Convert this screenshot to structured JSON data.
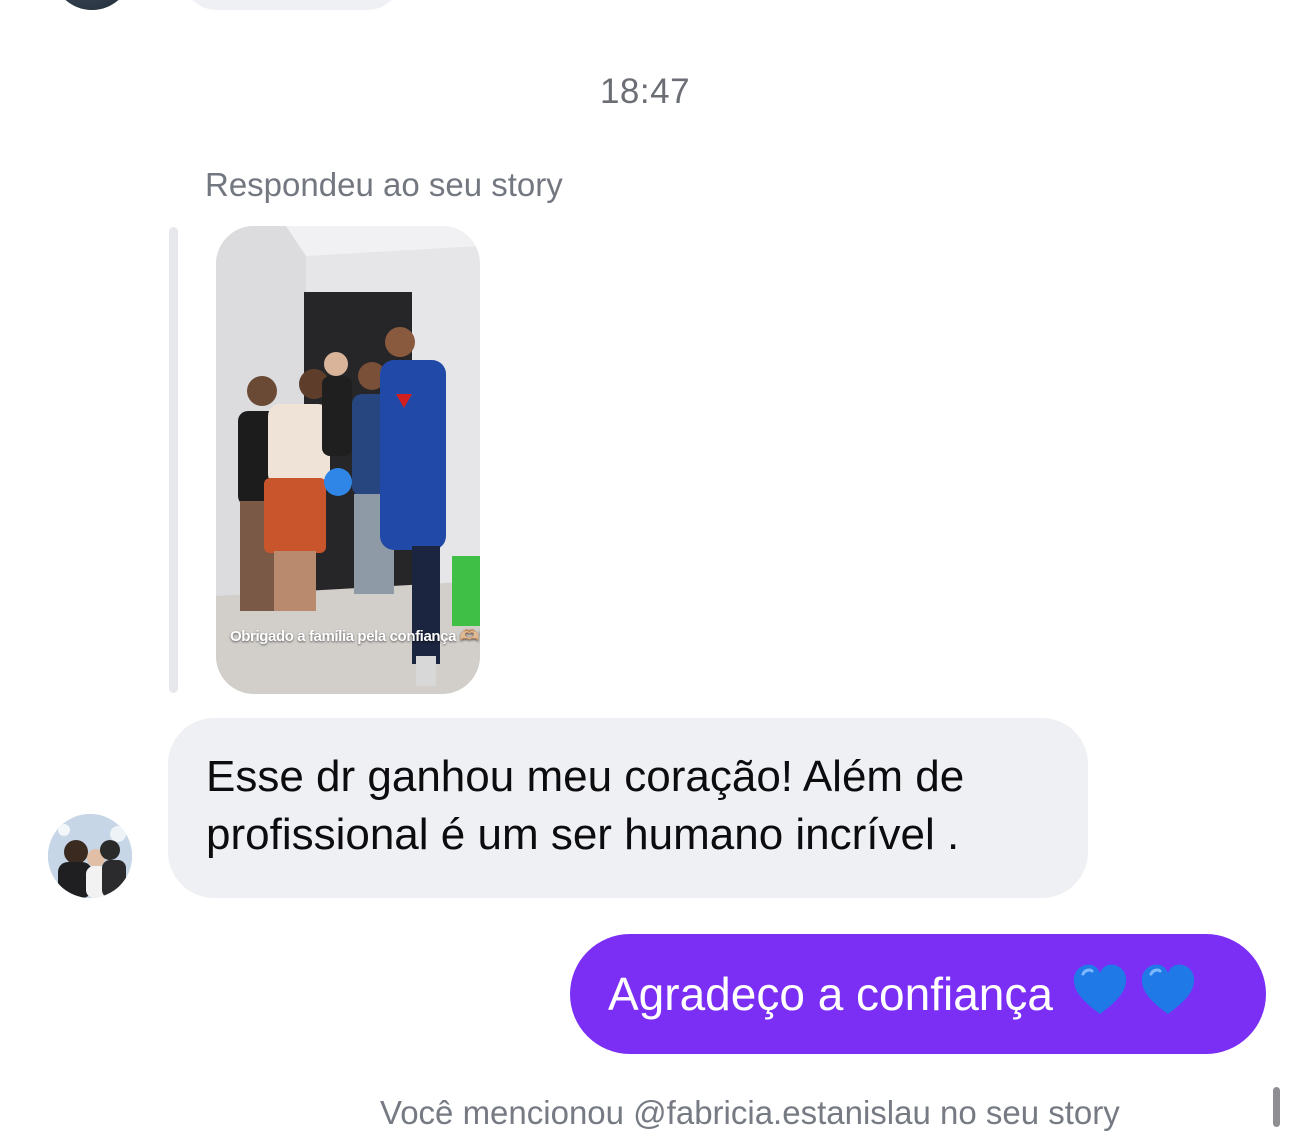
{
  "thread": {
    "timestamp": "18:47",
    "reply_label": "Respondeu ao seu story",
    "story": {
      "caption": "Obrigado a família pela confiança",
      "caption_emoji": "🫶🏼🤍"
    },
    "incoming_message": {
      "text": "Esse dr ganhou meu coração! Além de profissional é um ser humano incrível ."
    },
    "outgoing_message": {
      "text": "Agradeço a confiança",
      "emoji": [
        "blue-heart",
        "blue-heart"
      ]
    },
    "system_note": "Você mencionou @fabricia.estanislau no seu story"
  },
  "colors": {
    "outgoing_bubble": "#7b2ff5",
    "incoming_bubble": "#eff0f3",
    "meta_text": "#737780"
  }
}
